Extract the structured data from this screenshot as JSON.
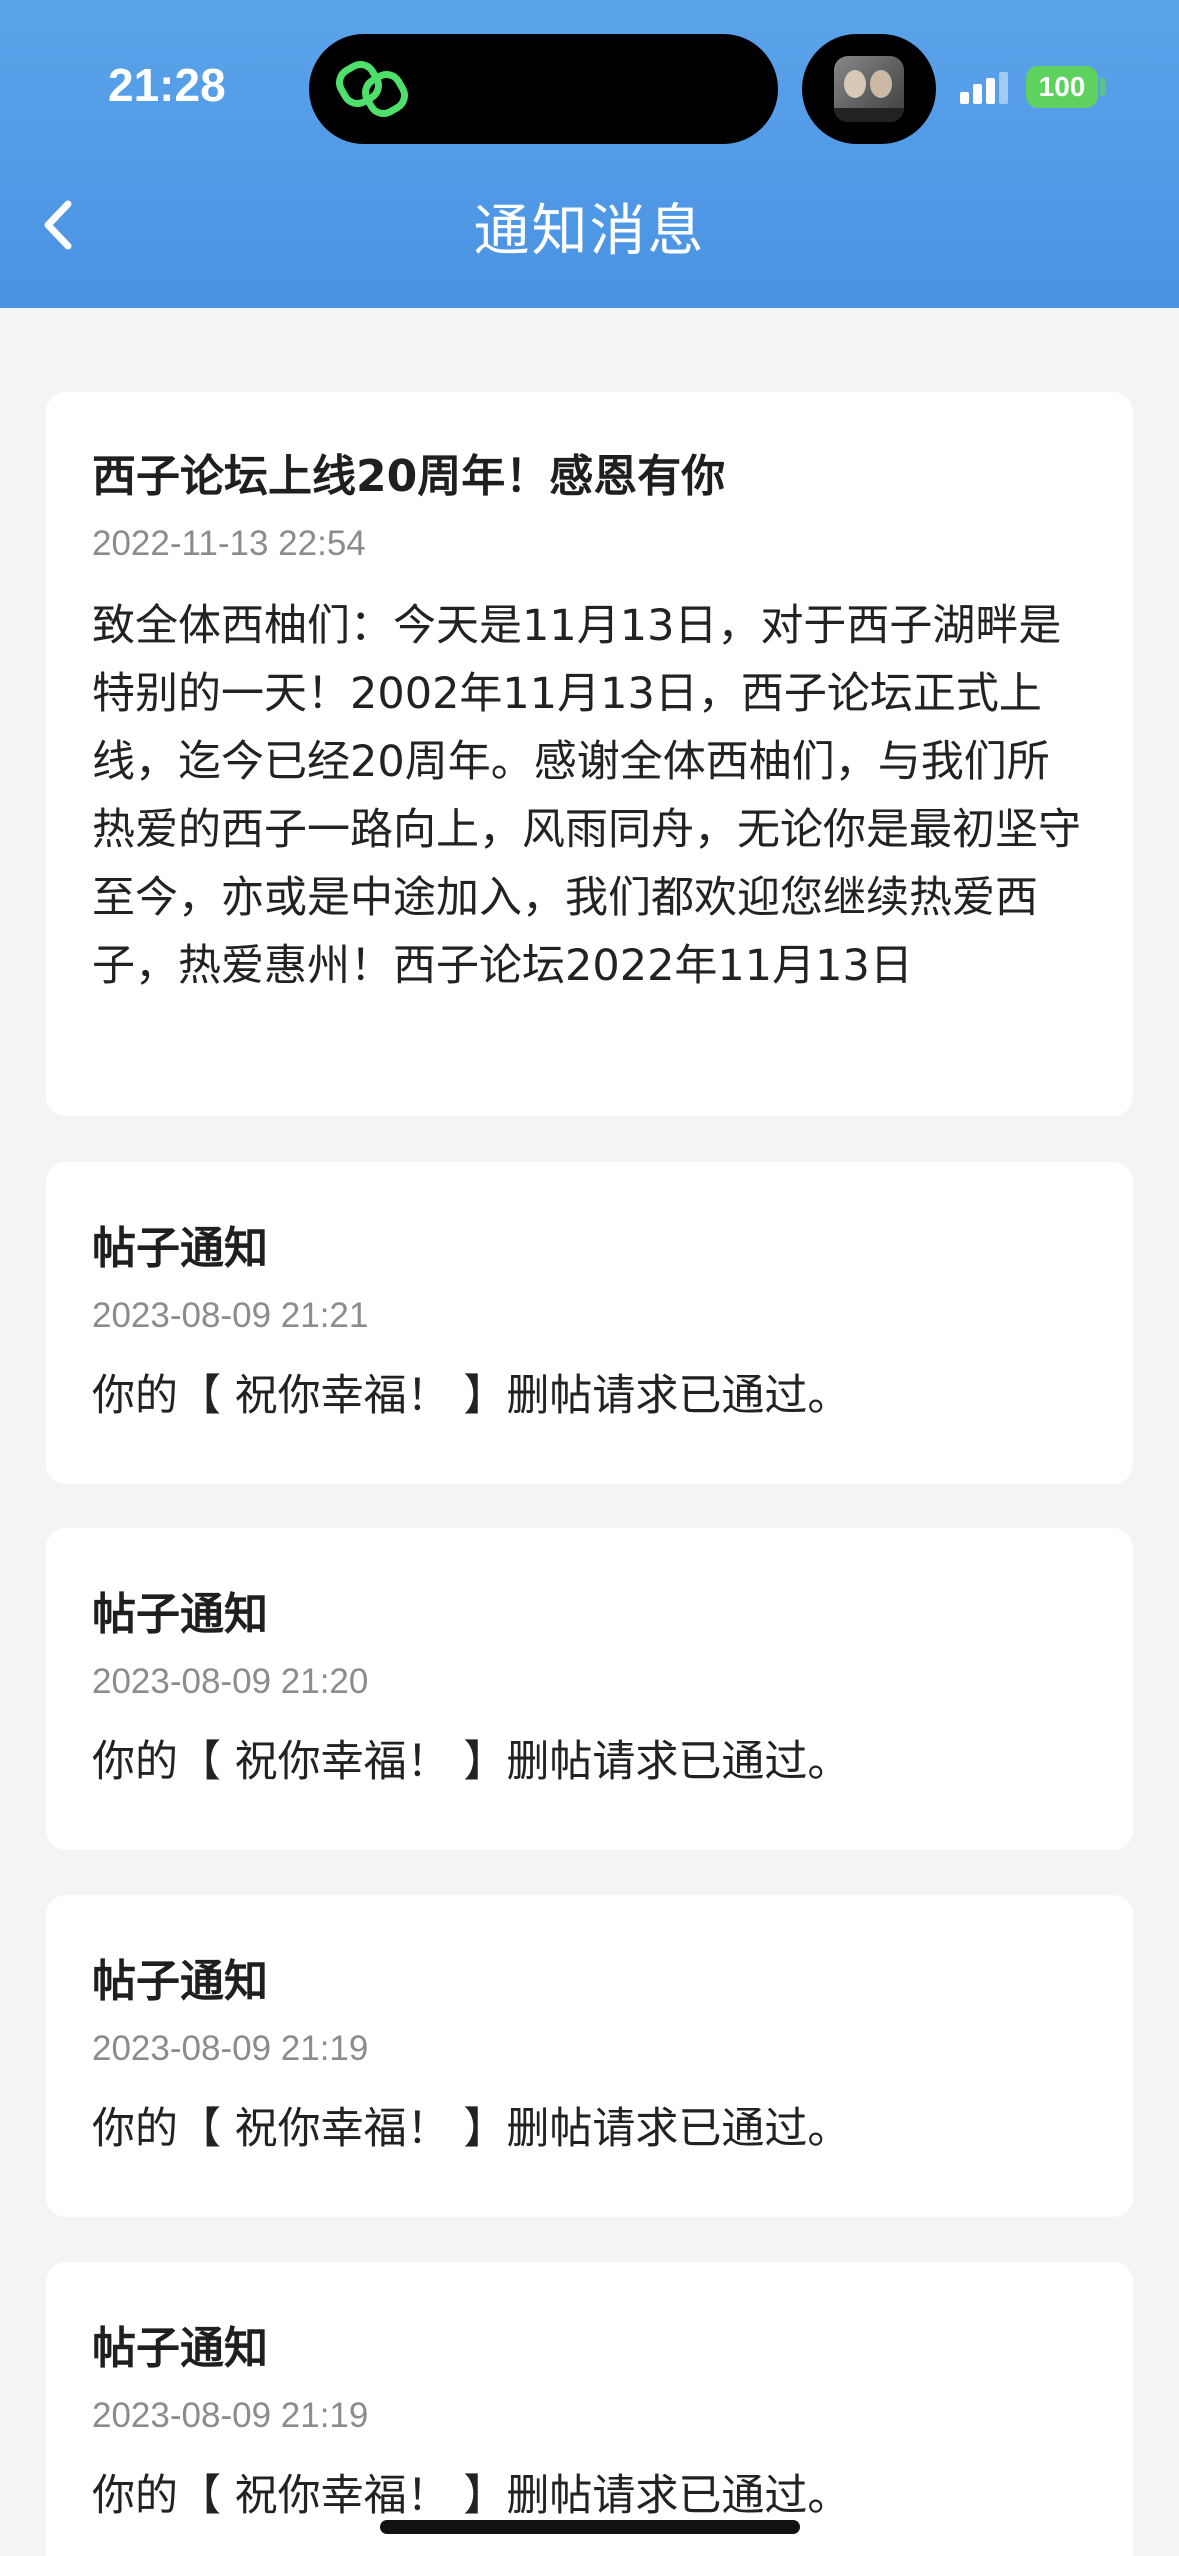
{
  "status_bar": {
    "time": "21:28",
    "battery": "100",
    "battery_color": "#5fd15f"
  },
  "nav": {
    "title": "通知消息",
    "back_icon": "chevron-left-icon",
    "background": "#4a93e3"
  },
  "notifications": [
    {
      "title": "西子论坛上线20周年！感恩有你",
      "time": "2022-11-13 22:54",
      "body": "致全体西柚们：今天是11月13日，对于西子湖畔是特别的一天！2002年11月13日，西子论坛正式上线，迄今已经20周年。感谢全体西柚们，与我们所热爱的西子一路向上，风雨同舟，无论你是最初坚守至今，亦或是中途加入，我们都欢迎您继续热爱西子，热爱惠州！西子论坛2022年11月13日"
    },
    {
      "title": "帖子通知",
      "time": "2023-08-09 21:21",
      "body": "你的【 祝你幸福！ 】删帖请求已通过。"
    },
    {
      "title": "帖子通知",
      "time": "2023-08-09 21:20",
      "body": "你的【 祝你幸福！ 】删帖请求已通过。"
    },
    {
      "title": "帖子通知",
      "time": "2023-08-09 21:19",
      "body": "你的【 祝你幸福！ 】删帖请求已通过。"
    },
    {
      "title": "帖子通知",
      "time": "2023-08-09 21:19",
      "body": "你的【 祝你幸福！ 】删帖请求已通过。"
    }
  ]
}
